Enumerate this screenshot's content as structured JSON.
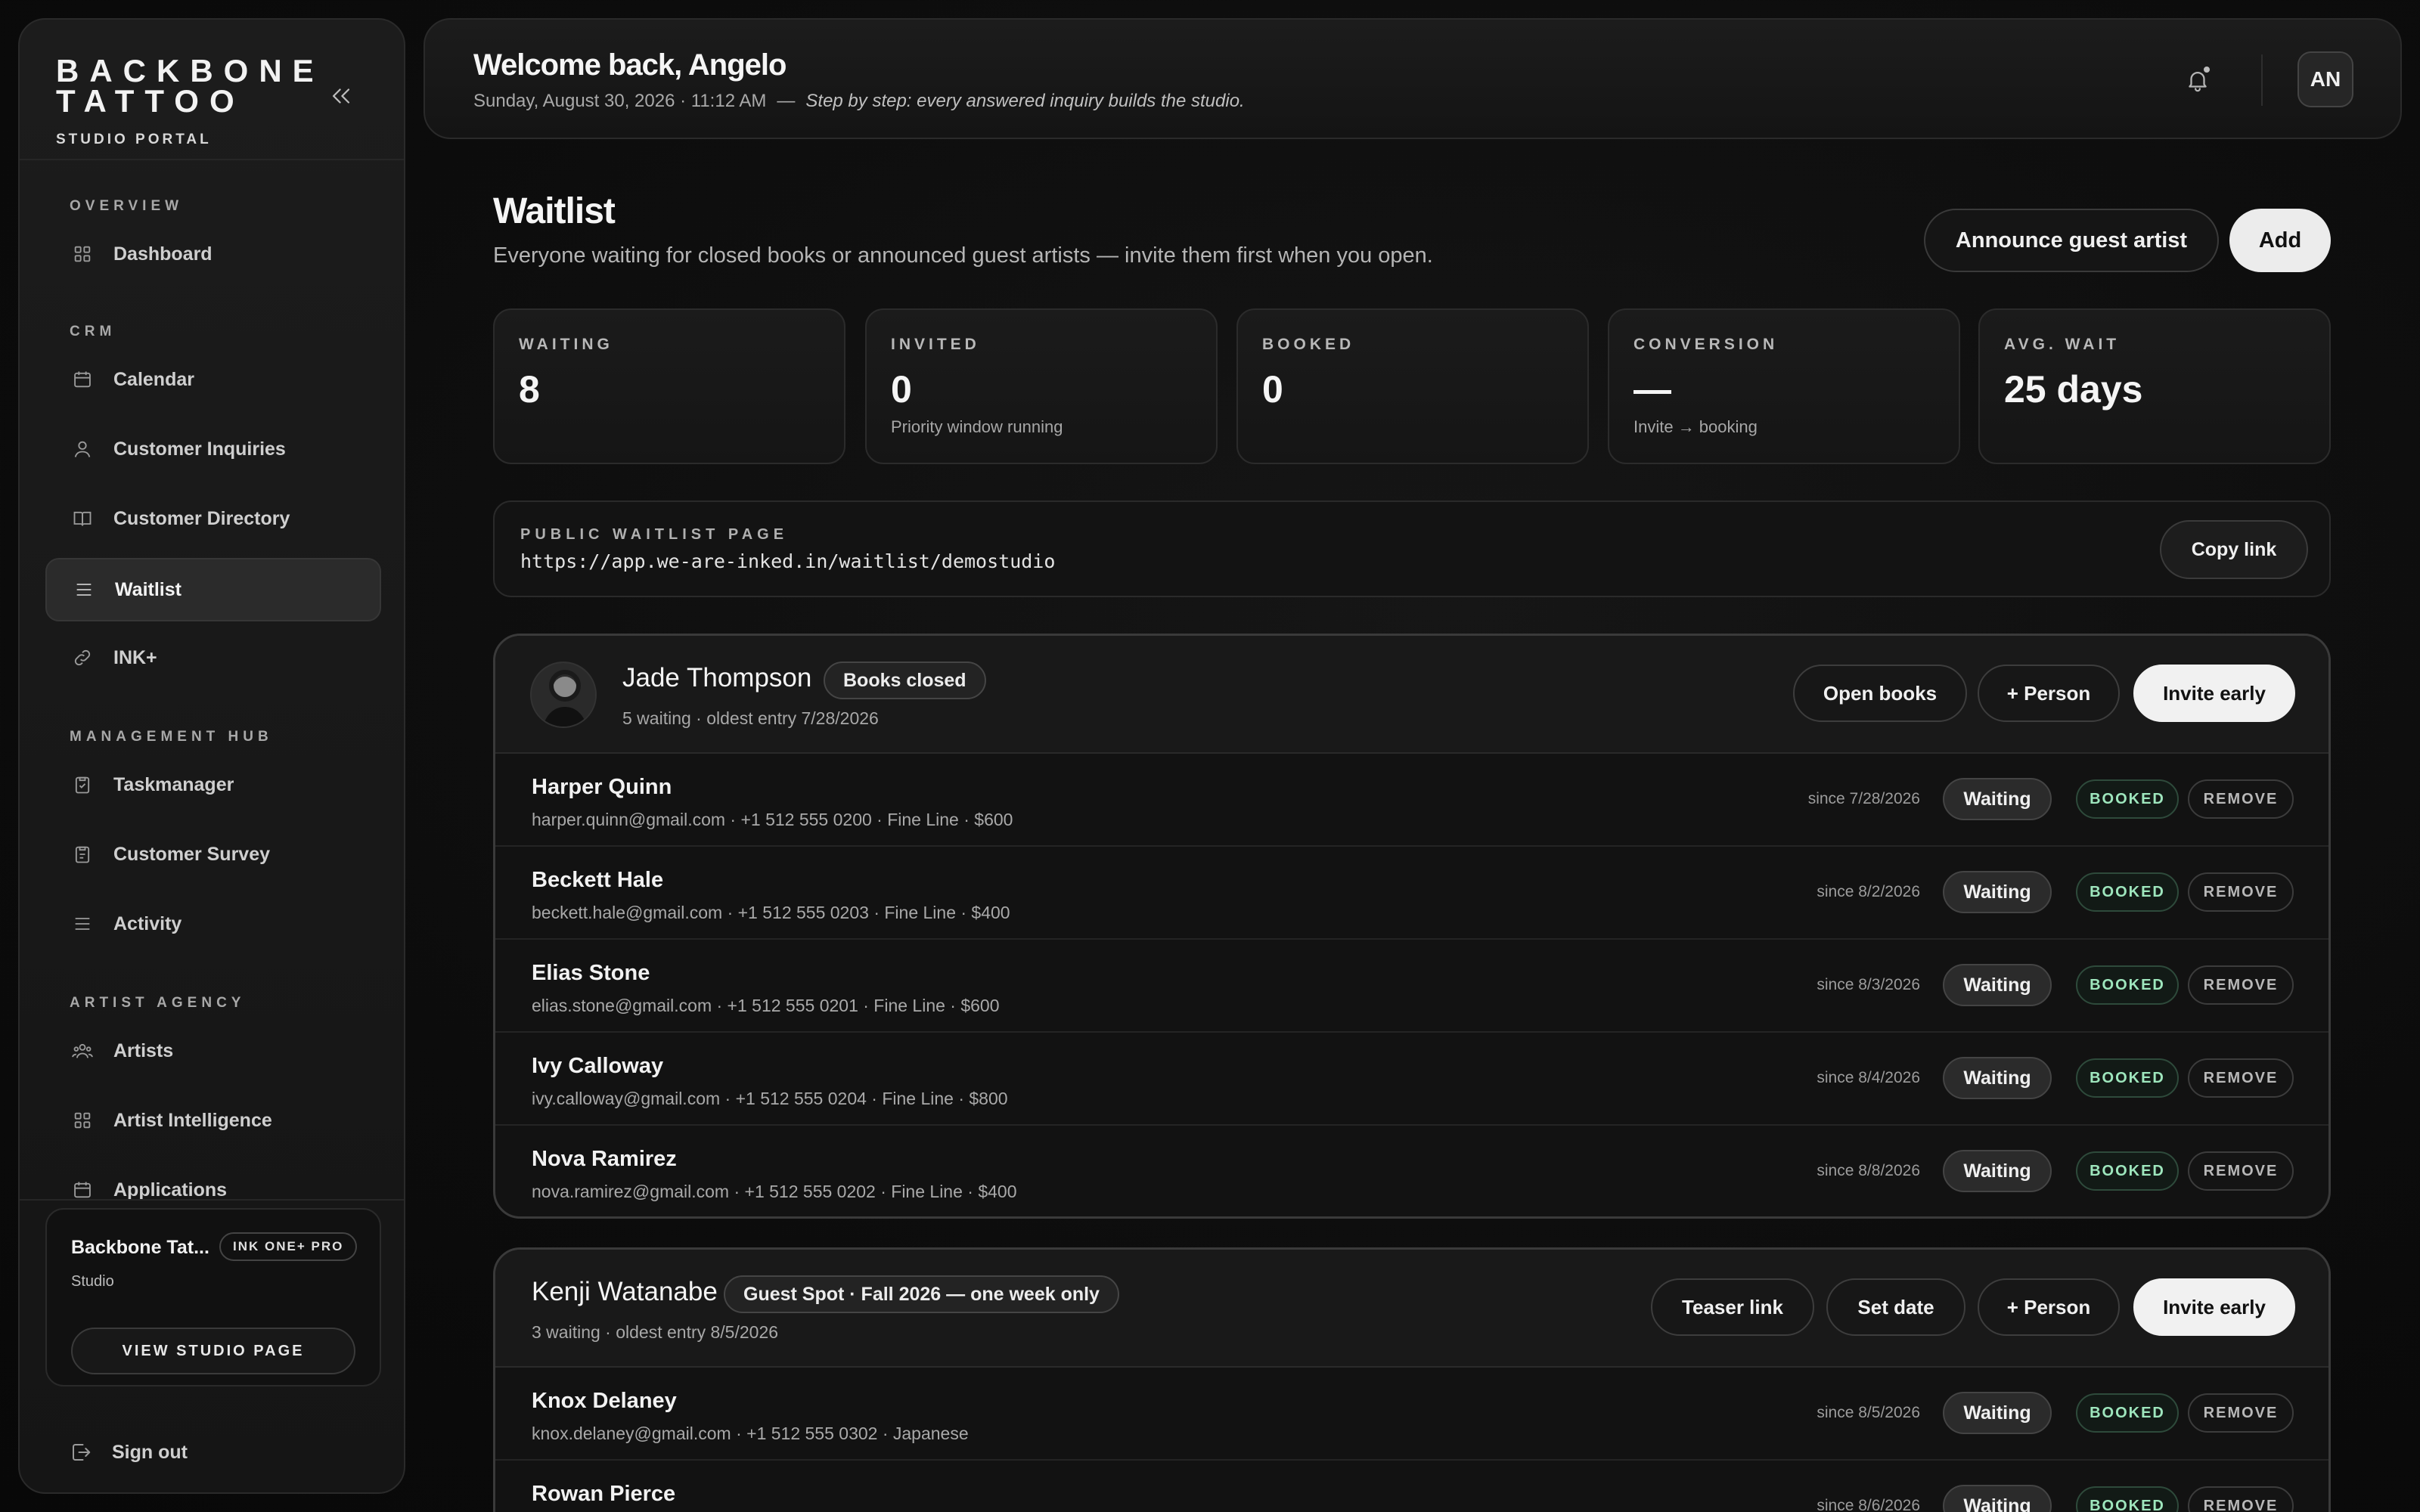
{
  "brand": {
    "line1": "BACKBONE",
    "line2": "TATTOO",
    "sub": "STUDIO PORTAL"
  },
  "sidebar": {
    "sections": {
      "overview": "OVERVIEW",
      "crm": "CRM",
      "management": "MANAGEMENT HUB",
      "agency": "ARTIST AGENCY"
    },
    "items": {
      "dashboard": "Dashboard",
      "calendar": "Calendar",
      "inquiries": "Customer Inquiries",
      "directory": "Customer Directory",
      "waitlist": "Waitlist",
      "inkplus": "INK+",
      "taskmanager": "Taskmanager",
      "survey": "Customer Survey",
      "activity": "Activity",
      "artists": "Artists",
      "intelligence": "Artist Intelligence",
      "applications": "Applications"
    },
    "studio": {
      "name": "Backbone Tat...",
      "plan": "INK ONE+ PRO",
      "type": "Studio",
      "view_button": "VIEW STUDIO PAGE"
    },
    "signout": "Sign out"
  },
  "header": {
    "welcome": "Welcome back, Angelo",
    "datetime": "Sunday, August 30, 2026 · 11:12 AM",
    "dash": "—",
    "tagline": "Step by step: every answered inquiry builds the studio.",
    "avatar": "AN"
  },
  "page": {
    "title": "Waitlist",
    "subtitle": "Everyone waiting for closed books or announced guest artists — invite them first when you open.",
    "announce_button": "Announce guest artist",
    "add_button": "Add"
  },
  "stats": [
    {
      "label": "WAITING",
      "value": "8",
      "note": ""
    },
    {
      "label": "INVITED",
      "value": "0",
      "note": "Priority window running"
    },
    {
      "label": "BOOKED",
      "value": "0",
      "note": ""
    },
    {
      "label": "CONVERSION",
      "value": "—",
      "note": "Invite → booking"
    },
    {
      "label": "AVG. WAIT",
      "value": "25 days",
      "note": ""
    }
  ],
  "public_page": {
    "label": "PUBLIC WAITLIST PAGE",
    "url": "https://app.we-are-inked.in/waitlist/demostudio",
    "copy_button": "Copy link"
  },
  "row_labels": {
    "booked": "BOOKED",
    "remove": "REMOVE"
  },
  "groups": [
    {
      "name": "Jade Thompson",
      "badge": "Books closed",
      "meta": "5 waiting · oldest entry 7/28/2026",
      "buttons": {
        "b1": "Open books",
        "b2": "+ Person",
        "b3": "Invite early"
      },
      "rows": [
        {
          "name": "Harper Quinn",
          "detail": "harper.quinn@gmail.com · +1 512 555 0200 · Fine Line · $600",
          "since": "since 7/28/2026",
          "status": "Waiting"
        },
        {
          "name": "Beckett Hale",
          "detail": "beckett.hale@gmail.com · +1 512 555 0203 · Fine Line · $400",
          "since": "since 8/2/2026",
          "status": "Waiting"
        },
        {
          "name": "Elias Stone",
          "detail": "elias.stone@gmail.com · +1 512 555 0201 · Fine Line · $600",
          "since": "since 8/3/2026",
          "status": "Waiting"
        },
        {
          "name": "Ivy Calloway",
          "detail": "ivy.calloway@gmail.com · +1 512 555 0204 · Fine Line · $800",
          "since": "since 8/4/2026",
          "status": "Waiting"
        },
        {
          "name": "Nova Ramirez",
          "detail": "nova.ramirez@gmail.com · +1 512 555 0202 · Fine Line · $400",
          "since": "since 8/8/2026",
          "status": "Waiting"
        }
      ]
    },
    {
      "name": "Kenji Watanabe",
      "badge": "Guest Spot · Fall 2026 — one week only",
      "meta": "3 waiting · oldest entry 8/5/2026",
      "buttons": {
        "b0": "Teaser link",
        "b1": "Set date",
        "b2": "+ Person",
        "b3": "Invite early"
      },
      "rows": [
        {
          "name": "Knox Delaney",
          "detail": "knox.delaney@gmail.com · +1 512 555 0302 · Japanese",
          "since": "since 8/5/2026",
          "status": "Waiting"
        },
        {
          "name": "Rowan Pierce",
          "detail": "",
          "since": "since 8/6/2026",
          "status": "Waiting"
        }
      ]
    }
  ],
  "colors": {
    "booked_text": "#9ee6bd",
    "accent_white": "#f1f1f1"
  }
}
